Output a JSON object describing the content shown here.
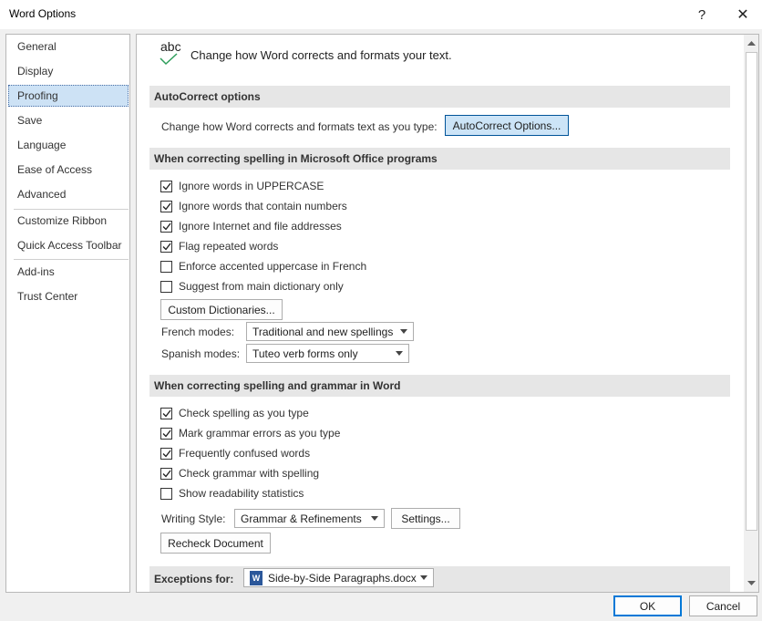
{
  "window": {
    "title": "Word Options",
    "help": "?",
    "close": "✕"
  },
  "nav": {
    "items": [
      {
        "label": "General"
      },
      {
        "label": "Display"
      },
      {
        "label": "Proofing"
      },
      {
        "label": "Save"
      },
      {
        "label": "Language"
      },
      {
        "label": "Ease of Access"
      },
      {
        "label": "Advanced"
      },
      {
        "label": "Customize Ribbon"
      },
      {
        "label": "Quick Access Toolbar"
      },
      {
        "label": "Add-ins"
      },
      {
        "label": "Trust Center"
      }
    ],
    "selected": "Proofing"
  },
  "header": {
    "icon_text": "abc",
    "text": "Change how Word corrects and formats your text."
  },
  "autocorrect": {
    "section_title": "AutoCorrect options",
    "label": "Change how Word corrects and formats text as you type:",
    "button": "AutoCorrect Options..."
  },
  "office_spelling": {
    "section_title": "When correcting spelling in Microsoft Office programs",
    "checkboxes": [
      {
        "label": "Ignore words in UPPERCASE",
        "checked": true
      },
      {
        "label": "Ignore words that contain numbers",
        "checked": true
      },
      {
        "label": "Ignore Internet and file addresses",
        "checked": true
      },
      {
        "label": "Flag repeated words",
        "checked": true
      },
      {
        "label": "Enforce accented uppercase in French",
        "checked": false
      },
      {
        "label": "Suggest from main dictionary only",
        "checked": false
      }
    ],
    "custom_dict_button": "Custom Dictionaries...",
    "french_label": "French modes:",
    "french_value": "Traditional and new spellings",
    "spanish_label": "Spanish modes:",
    "spanish_value": "Tuteo verb forms only"
  },
  "word_spelling": {
    "section_title": "When correcting spelling and grammar in Word",
    "checkboxes": [
      {
        "label": "Check spelling as you type",
        "checked": true
      },
      {
        "label": "Mark grammar errors as you type",
        "checked": true
      },
      {
        "label": "Frequently confused words",
        "checked": true
      },
      {
        "label": "Check grammar with spelling",
        "checked": true
      },
      {
        "label": "Show readability statistics",
        "checked": false
      }
    ],
    "writing_style_label": "Writing Style:",
    "writing_style_value": "Grammar & Refinements",
    "settings_button": "Settings...",
    "recheck_button": "Recheck Document"
  },
  "exceptions": {
    "label": "Exceptions for:",
    "doc_icon": "W",
    "value": "Side-by-Side Paragraphs.docx"
  },
  "footer": {
    "ok": "OK",
    "cancel": "Cancel"
  },
  "colors": {
    "accent": "#0078d7",
    "selected_nav": "#cde2f5",
    "section_bg": "#e6e6e6",
    "primary_button": "#cce4f7"
  }
}
